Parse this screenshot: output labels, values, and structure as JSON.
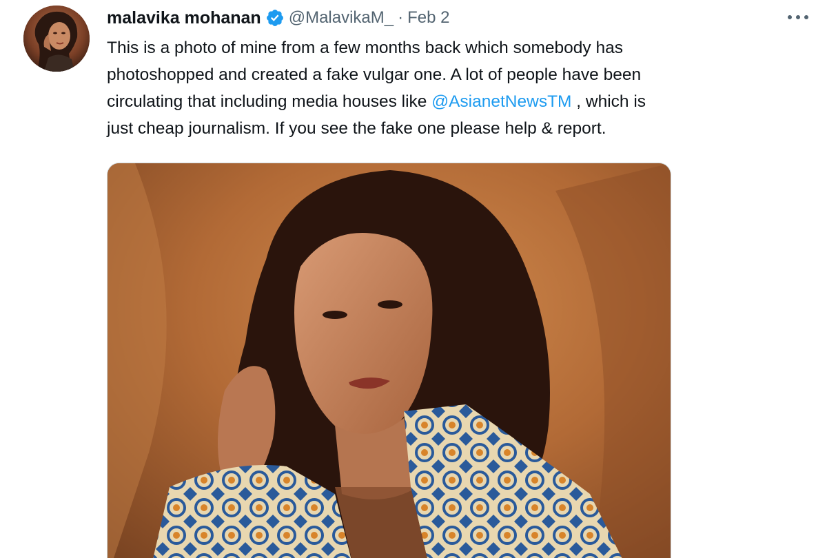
{
  "tweet": {
    "author": {
      "display_name": "malavika mohanan",
      "handle": "@MalavikaM_",
      "verified": true
    },
    "separator": "·",
    "timestamp": "Feb 2",
    "more_icon": "more-horizontal-icon",
    "text": {
      "line1": "This is a photo of mine from a few months back which somebody has",
      "line2": "photoshopped and created a fake vulgar one. A lot of people have been",
      "line3_before": "circulating that including media houses like ",
      "line3_mention": "@AsianetNewsTM",
      "line3_after": " , which is",
      "line4": "just cheap journalism. If you see the fake one please help & report."
    },
    "colors": {
      "text": "#0f1419",
      "secondary": "#536471",
      "link": "#1d9bf0",
      "verified": "#1d9bf0"
    }
  }
}
